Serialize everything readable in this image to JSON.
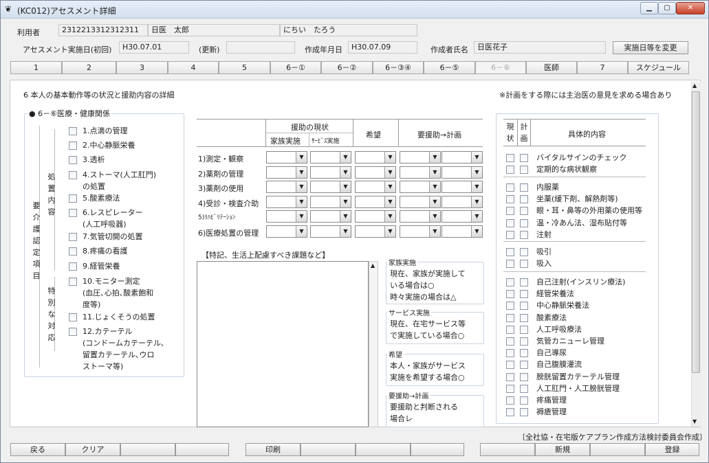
{
  "window": {
    "icon": "gear-icon",
    "title": "(KC012)アセスメント詳細",
    "min": "▁",
    "max": "▢",
    "close": "✕"
  },
  "header": {
    "user_label": "利用者",
    "user_id": "2312213312312311",
    "user_name": "日医　太郎",
    "user_kana": "にちい　たろう",
    "first_date_label": "アセスメント実施日(初回)",
    "first_date": "H30.07.01",
    "update_label": "(更新)",
    "update_date": "",
    "created_label": "作成年月日",
    "created_date": "H30.07.09",
    "author_label": "作成者氏名",
    "author": "日医花子",
    "change_button": "実施日等を変更"
  },
  "tabs": [
    "1",
    "2",
    "3",
    "4",
    "5",
    "6－①",
    "6－②",
    "6－③④",
    "6－⑤",
    "6－⑥",
    "医師",
    "7",
    "スケジュール"
  ],
  "section": {
    "title": "6 本人の基本動作等の状況と援助内容の詳細",
    "note": "※計画をする際には主治医の意見を求める場合あり"
  },
  "left": {
    "group_title": "● 6－⑥医療・健康関係",
    "outer_label": "要介護認定項目",
    "label_shochi": "処置内容",
    "label_tokubetsu": "特別な対応",
    "items": [
      "1.点滴の管理",
      "2.中心静脈栄養",
      "3.透析",
      "4.ストーマ(人工肛門)",
      "の処置",
      "5.酸素療法",
      "6.レスピレーター",
      "(人工呼吸器)",
      "7.気管切開の処置",
      "8.疼痛の看護",
      "9.経管栄養",
      "10.モニター測定",
      "(血圧､心拍､酸素飽和",
      "度等)",
      "11.じょくそうの処置",
      "12.カテーテル",
      "(コンドームカテーテル､",
      "留置カテーテル､ウロ",
      "ストーマ等)"
    ]
  },
  "middle": {
    "h_support": "援助の現状",
    "h_family": "家族実施",
    "h_service": "ｻｰﾋﾞｽ実施",
    "h_hope": "希望",
    "h_plan": "要援助→計画",
    "rows": [
      "1)測定・観察",
      "2)薬剤の管理",
      "3)薬剤の使用",
      "4)受診・検査介助",
      "5)ﾘﾊﾋﾞﾘﾃｰｼｮﾝ",
      "6)医療処置の管理"
    ],
    "memo_title": "【特記、生活上配慮すべき課題など】",
    "legend": [
      {
        "title": "家族実施",
        "lines": [
          "現在、家族が実施して",
          "いる場合は○",
          "時々実施の場合は△"
        ]
      },
      {
        "title": "サービス実施",
        "lines": [
          "現在、在宅サービス等",
          "で実施している場合○"
        ]
      },
      {
        "title": "希望",
        "lines": [
          "本人・家族がサービス",
          "実施を希望する場合○"
        ]
      },
      {
        "title": "要援助→計画",
        "lines": [
          "要援助と判断される",
          "場合レ"
        ]
      }
    ]
  },
  "right": {
    "h_genjo": "現状",
    "h_keikaku": "計画",
    "h_detail": "具体的内容",
    "groups": [
      [
        "バイタルサインのチェック",
        "定期的な病状観察"
      ],
      [
        "内服薬",
        "坐薬(緩下剤、解熱剤等)",
        "眼・耳・鼻等の外用薬の使用等",
        "温・冷あん法、湿布貼付等",
        "注射"
      ],
      [
        "吸引",
        "吸入"
      ],
      [
        "自己注射(インスリン療法)",
        "経管栄養法",
        "中心静脈栄養法",
        "酸素療法",
        "人工呼吸療法",
        "気管カニューレ管理",
        "自己導尿",
        "自己腹膜灌流",
        "膀胱留置カテーテル管理",
        "人工肛門・人工膀胱管理",
        "疼痛管理",
        "褥瘡管理"
      ]
    ]
  },
  "footer_note": "〔全社協・在宅版ケアプラン作成方法検討委員会作成〕",
  "bottom": {
    "back": "戻る",
    "clear": "クリア",
    "print": "印刷",
    "new": "新規",
    "register": "登録"
  },
  "colors": {
    "accent": "#c8402a",
    "panel": "#ffffff",
    "border": "#c9d3df"
  }
}
